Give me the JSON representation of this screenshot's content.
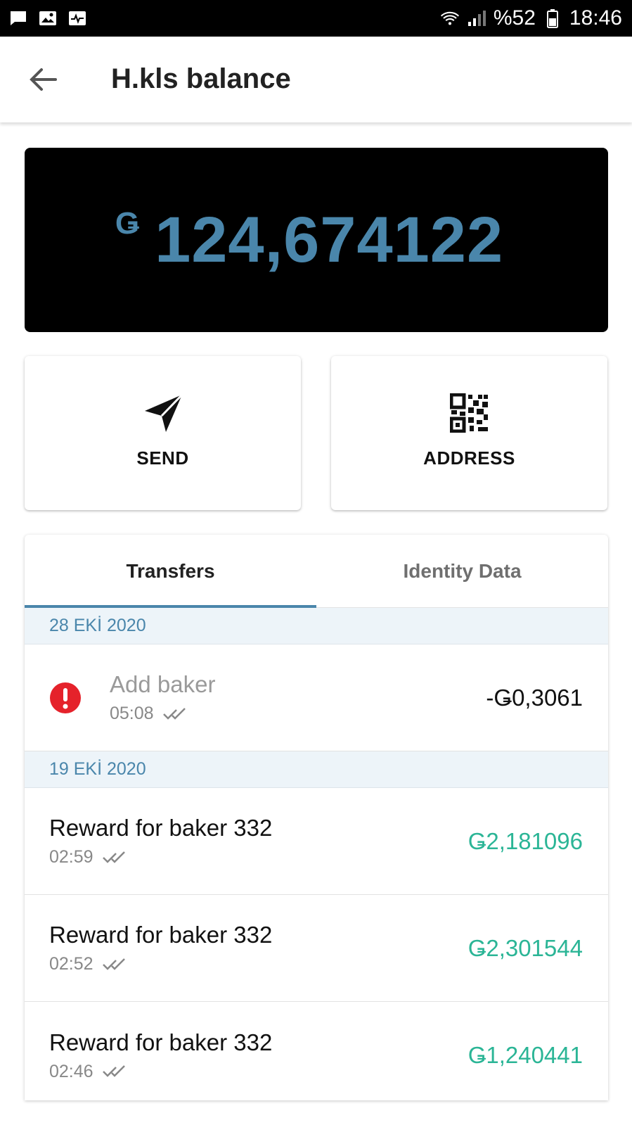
{
  "status_bar": {
    "battery": "%52",
    "time": "18:46",
    "icons": [
      "chat-icon",
      "image-icon",
      "activity-icon",
      "wifi-icon",
      "signal-icon",
      "battery-icon"
    ]
  },
  "app_bar": {
    "title": "H.kls balance",
    "back_icon": "back-arrow-icon"
  },
  "balance": {
    "currency_symbol": "Ǥ",
    "amount": "124,674122",
    "color": "#4a86ab"
  },
  "actions": {
    "send_label": "SEND",
    "send_icon": "send-icon",
    "address_label": "ADDRESS",
    "address_icon": "qr-code-icon"
  },
  "tabs": [
    {
      "label": "Transfers",
      "active": true
    },
    {
      "label": "Identity Data",
      "active": false
    }
  ],
  "transactions": {
    "groups": [
      {
        "date": "28 EKİ 2020",
        "items": [
          {
            "title": "Add baker",
            "time": "05:08",
            "amount": "-Ǥ0,3061",
            "status": "failed"
          }
        ]
      },
      {
        "date": "19 EKİ 2020",
        "items": [
          {
            "title": "Reward for baker 332",
            "time": "02:59",
            "amount": "Ǥ2,181096"
          },
          {
            "title": "Reward for baker 332",
            "time": "02:52",
            "amount": "Ǥ2,301544"
          },
          {
            "title": "Reward for baker 332",
            "time": "02:46",
            "amount": "Ǥ1,240441"
          }
        ]
      }
    ]
  },
  "colors": {
    "accent": "#4a86ab",
    "positive": "#2bb596",
    "error": "#e5222b",
    "date_header_bg": "#edf4f9"
  }
}
